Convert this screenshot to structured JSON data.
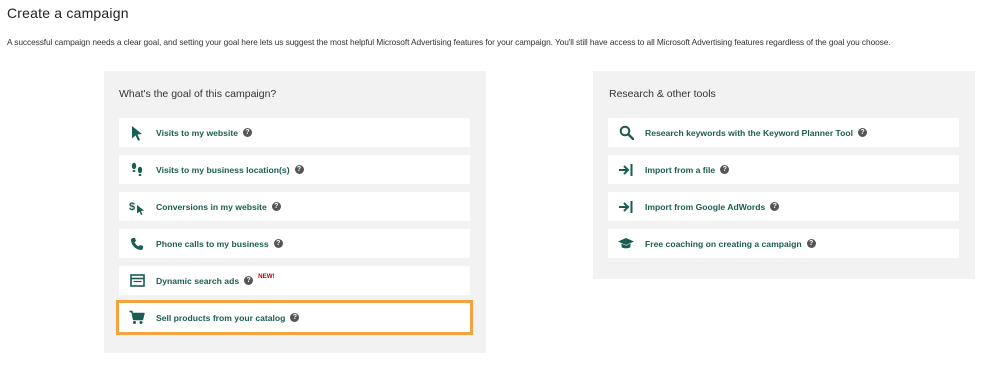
{
  "page": {
    "title": "Create a campaign",
    "description": "A successful campaign needs a clear goal, and setting your goal here lets us suggest the most helpful Microsoft Advertising features for your campaign. You'll still have access to all Microsoft Advertising features regardless of the goal you choose."
  },
  "goal_panel": {
    "heading": "What's the goal of this campaign?",
    "items": [
      {
        "label": "Visits to my website",
        "icon": "cursor-icon"
      },
      {
        "label": "Visits to my business location(s)",
        "icon": "footsteps-icon"
      },
      {
        "label": "Conversions in my website",
        "icon": "dollar-cursor-icon"
      },
      {
        "label": "Phone calls to my business",
        "icon": "phone-icon"
      },
      {
        "label": "Dynamic search ads",
        "icon": "browser-icon",
        "badge": "NEW!"
      },
      {
        "label": "Sell products from your catalog",
        "icon": "shopping-cart-icon",
        "highlighted": true
      }
    ]
  },
  "tools_panel": {
    "heading": "Research & other tools",
    "items": [
      {
        "label": "Research keywords with the Keyword Planner Tool",
        "icon": "search-icon"
      },
      {
        "label": "Import from a file",
        "icon": "import-icon"
      },
      {
        "label": "Import from Google AdWords",
        "icon": "import-icon"
      },
      {
        "label": "Free coaching on creating a campaign",
        "icon": "graduation-cap-icon"
      }
    ]
  },
  "help_glyph": "?",
  "colors": {
    "accent": "#1a5d52",
    "panel_bg": "#f2f2f2",
    "highlight": "#f4a340",
    "badge": "#c00000"
  }
}
